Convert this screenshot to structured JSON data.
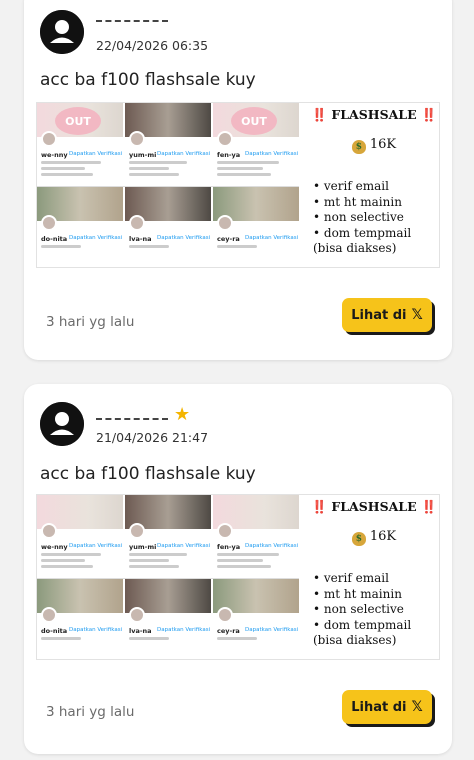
{
  "posts": [
    {
      "username": "",
      "has_star": false,
      "timestamp": "22/04/2026 06:35",
      "text": "acc ba f100 flashsale kuy",
      "image": {
        "title_mark_left": "‼️",
        "title": "FLASHSALE",
        "title_mark_right": "‼️",
        "price": "16K",
        "features": [
          "• verif email",
          "• mt ht mainin",
          "• non selective",
          "• dom tempmail",
          "(bisa diakses)"
        ],
        "accounts": [
          {
            "handle": "we-nny",
            "badge": "Dapatkan Verifikasi"
          },
          {
            "handle": "yum-mi",
            "badge": "Dapatkan Verifikasi"
          },
          {
            "handle": "fen-ya",
            "badge": "Dapatkan Verifikasi"
          },
          {
            "handle": "do-nita",
            "badge": "Dapatkan Verifikasi"
          },
          {
            "handle": "lva-na",
            "badge": "Dapatkan Verifikasi"
          },
          {
            "handle": "cey-ra",
            "badge": "Dapatkan Verifikasi"
          }
        ],
        "out_label": "OUT"
      },
      "relative_time": "3 hari yg lalu",
      "button_label": "Lihat di",
      "button_icon": "x-logo-icon"
    },
    {
      "username": "",
      "has_star": true,
      "timestamp": "21/04/2026 21:47",
      "text": "acc ba f100 flashsale kuy",
      "image": {
        "title_mark_left": "‼️",
        "title": "FLASHSALE",
        "title_mark_right": "‼️",
        "price": "16K",
        "features": [
          "• verif email",
          "• mt ht mainin",
          "• non selective",
          "• dom tempmail",
          "(bisa diakses)"
        ],
        "accounts": [
          {
            "handle": "we-nny",
            "badge": "Dapatkan Verifikasi"
          },
          {
            "handle": "yum-mi",
            "badge": "Dapatkan Verifikasi"
          },
          {
            "handle": "fen-ya",
            "badge": "Dapatkan Verifikasi"
          },
          {
            "handle": "do-nita",
            "badge": "Dapatkan Verifikasi"
          },
          {
            "handle": "lva-na",
            "badge": "Dapatkan Verifikasi"
          },
          {
            "handle": "cey-ra",
            "badge": "Dapatkan Verifikasi"
          }
        ],
        "out_label": ""
      },
      "relative_time": "3 hari yg lalu",
      "button_label": "Lihat di",
      "button_icon": "x-logo-icon"
    }
  ],
  "colors": {
    "button_bg": "#f6c31a",
    "star": "#f4b400",
    "alert_red": "#d92d20"
  }
}
